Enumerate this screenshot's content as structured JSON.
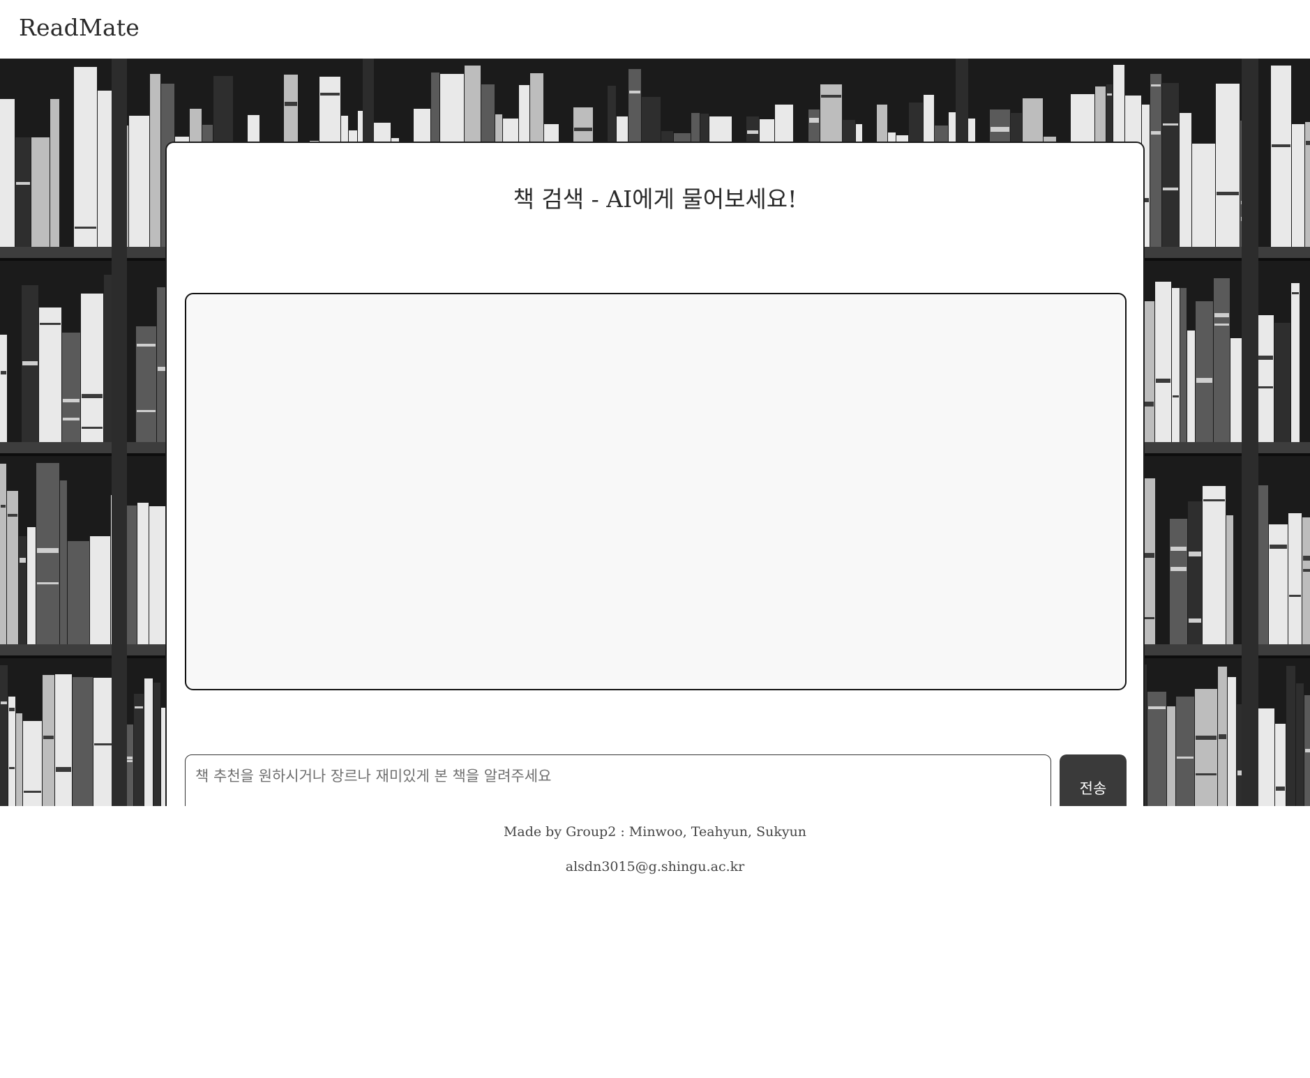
{
  "header": {
    "brand": "ReadMate"
  },
  "main": {
    "title": "책 검색 - AI에게 물어보세요!",
    "input_placeholder": "책 추천을 원하시거나 장르나 재미있게 본 책을 알려주세요",
    "input_value": "",
    "send_label": "전송"
  },
  "footer": {
    "credit": "Made by Group2 : Minwoo, Teahyun, Sukyun",
    "email": "alsdn3015@g.shingu.ac.kr"
  },
  "colors": {
    "send_button_bg": "#3a3a3a",
    "chat_box_bg": "#f8f8f8",
    "hero_bg": "#121212"
  }
}
